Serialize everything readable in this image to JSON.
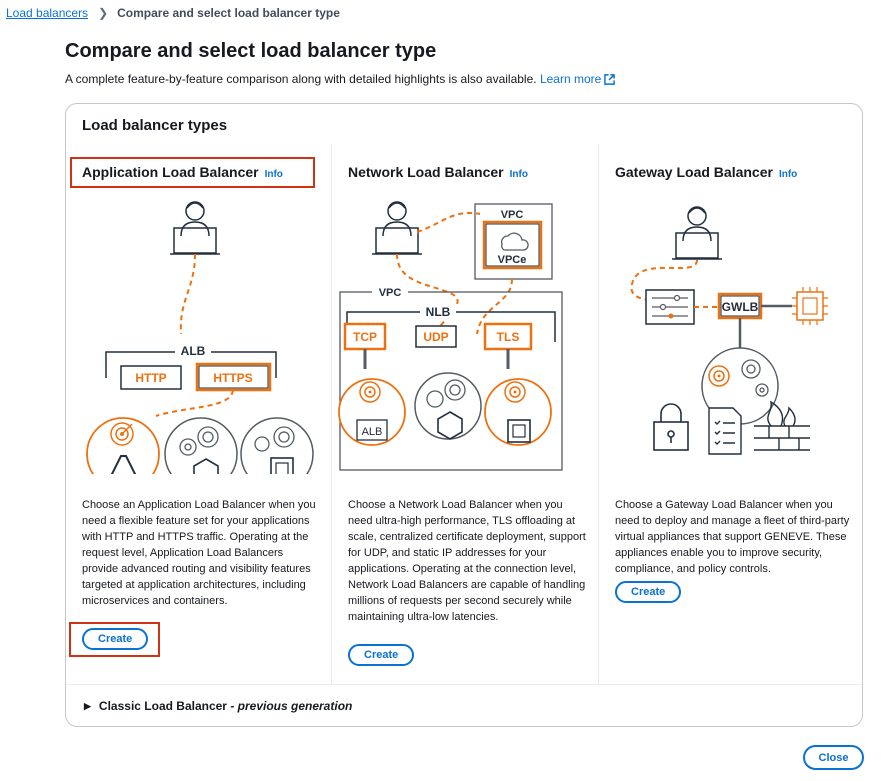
{
  "breadcrumb": {
    "parent": "Load balancers",
    "current": "Compare and select load balancer type"
  },
  "page": {
    "title": "Compare and select load balancer type",
    "subtitle": "A complete feature-by-feature comparison along with detailed highlights is also available.",
    "learn_more": "Learn more"
  },
  "container": {
    "title": "Load balancer types"
  },
  "types": [
    {
      "title": "Application Load Balancer",
      "info": "Info",
      "description": "Choose an Application Load Balancer when you need a flexible feature set for your applications with HTTP and HTTPS traffic. Operating at the request level, Application Load Balancers provide advanced routing and visibility features targeted at application architectures, including microservices and containers.",
      "create": "Create",
      "diagram": {
        "group": "ALB",
        "listener1": "HTTP",
        "listener2": "HTTPS"
      }
    },
    {
      "title": "Network Load Balancer",
      "info": "Info",
      "description": "Choose a Network Load Balancer when you need ultra-high performance, TLS offloading at scale, centralized certificate deployment, support for UDP, and static IP addresses for your applications. Operating at the connection level, Network Load Balancers are capable of handling millions of requests per second securely while maintaining ultra-low latencies.",
      "create": "Create",
      "diagram": {
        "vpc_top": "VPC",
        "vpce": "VPCe",
        "vpc": "VPC",
        "group": "NLB",
        "listener1": "TCP",
        "listener2": "UDP",
        "listener3": "TLS",
        "target": "ALB"
      }
    },
    {
      "title": "Gateway Load Balancer",
      "info": "Info",
      "description": "Choose a Gateway Load Balancer when you need to deploy and manage a fleet of third-party virtual appliances that support GENEVE. These appliances enable you to improve security, compliance, and policy controls.",
      "create": "Create",
      "diagram": {
        "gateway": "GWLB"
      }
    }
  ],
  "classic": {
    "label": "Classic Load Balancer - ",
    "suffix": "previous generation"
  },
  "footer": {
    "close": "Close"
  },
  "colors": {
    "link": "#0972d3",
    "accent": "#ec7211",
    "highlight": "#d13212",
    "dark": "#232f3e"
  }
}
